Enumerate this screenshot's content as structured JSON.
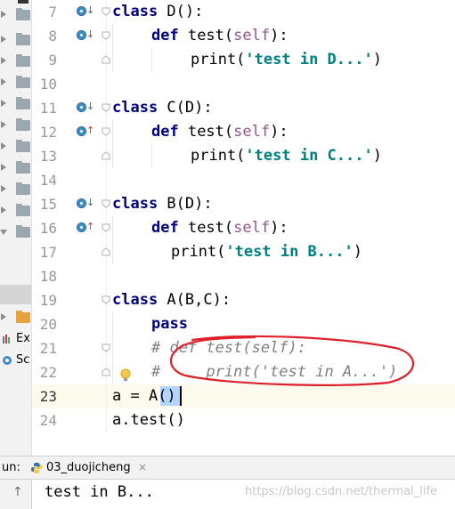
{
  "project_tree": {
    "items": [
      {
        "type": "collapsed-folder",
        "icon": "folder-icon"
      },
      {
        "type": "collapsed-folder",
        "icon": "folder-icon"
      },
      {
        "type": "collapsed-folder",
        "icon": "folder-icon"
      },
      {
        "type": "collapsed-folder",
        "icon": "folder-icon"
      },
      {
        "type": "collapsed-folder",
        "icon": "folder-icon"
      },
      {
        "type": "collapsed-folder",
        "icon": "folder-icon"
      },
      {
        "type": "collapsed-folder",
        "icon": "folder-icon"
      },
      {
        "type": "collapsed-folder",
        "icon": "folder-icon"
      },
      {
        "type": "collapsed-folder",
        "icon": "folder-icon"
      },
      {
        "type": "collapsed-folder",
        "icon": "folder-icon"
      },
      {
        "type": "expanded-folder",
        "icon": "folder-icon"
      }
    ],
    "orange_folder_icon": "folder-icon",
    "external_libraries_label": "Ex",
    "scratches_label": "Sc"
  },
  "editor": {
    "line_numbers": [
      "7",
      "8",
      "9",
      "10",
      "11",
      "12",
      "13",
      "14",
      "15",
      "16",
      "17",
      "18",
      "19",
      "20",
      "21",
      "22",
      "23",
      "24"
    ],
    "current_line": "23",
    "colors": {
      "keyword": "#000080",
      "self": "#94558d",
      "string": "#008080",
      "comment": "#808080",
      "current_line_bg": "#fcfaed",
      "selection": "#b3d4fc"
    },
    "lines": {
      "l7": {
        "kw": "class",
        "rest": " D():"
      },
      "l8": {
        "kw": "def",
        "name": " test(",
        "self": "self",
        "end": "):"
      },
      "l9": {
        "fn": "print(",
        "str": "'test in D...'",
        "end": ")"
      },
      "l11": {
        "kw": "class",
        "rest": " C(D):"
      },
      "l12": {
        "kw": "def",
        "name": " test(",
        "self": "self",
        "end": "):"
      },
      "l13": {
        "fn": "print(",
        "str": "'test in C...'",
        "end": ")"
      },
      "l15": {
        "kw": "class",
        "rest": " B(D):"
      },
      "l16": {
        "kw": "def",
        "name": " test(",
        "self": "self",
        "end": "):"
      },
      "l17": {
        "fn": "print(",
        "str": "'test in B...'",
        "end": ")"
      },
      "l19": {
        "kw": "class",
        "rest": " A(B,C):"
      },
      "l20": {
        "kw": "pass"
      },
      "l21": {
        "comment": "# def test(self):"
      },
      "l22": {
        "comment": "#     print('test in A...')"
      },
      "l23": {
        "start": "a = A",
        "selected": "()"
      },
      "l24": {
        "text": "a.test()"
      }
    },
    "gutter_icons": {
      "overridden": "overridden-method-icon",
      "overriding": "overriding-method-icon",
      "fold": "fold-marker-icon",
      "intention": "lightbulb-icon"
    }
  },
  "run_panel": {
    "label": "un:",
    "tab_name": "03_duojicheng",
    "close_glyph": "×",
    "up_glyph": "↑",
    "output": "test in B..."
  },
  "watermark": "https://blog.csdn.net/thermal_life"
}
